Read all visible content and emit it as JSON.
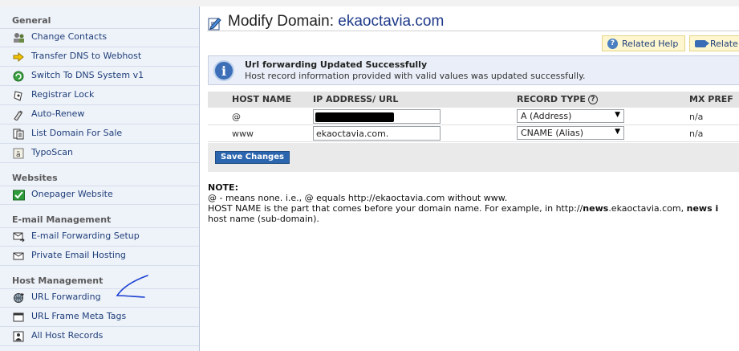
{
  "sidebar": {
    "sections": [
      {
        "title": "General",
        "items": [
          {
            "label": "Change Contacts",
            "icon": "contacts-icon"
          },
          {
            "label": "Transfer DNS to Webhost",
            "icon": "arrow-icon"
          },
          {
            "label": "Switch To DNS System v1",
            "icon": "switch-icon"
          },
          {
            "label": "Registrar Lock",
            "icon": "lock-icon"
          },
          {
            "label": "Auto-Renew",
            "icon": "renew-icon"
          },
          {
            "label": "List Domain For Sale",
            "icon": "sale-icon"
          },
          {
            "label": "TypoScan",
            "icon": "typoscan-icon"
          }
        ]
      },
      {
        "title": "Websites",
        "items": [
          {
            "label": "Onepager Website",
            "icon": "checkmark-icon"
          }
        ]
      },
      {
        "title": "E-mail Management",
        "items": [
          {
            "label": "E-mail Forwarding Setup",
            "icon": "email-forward-icon"
          },
          {
            "label": "Private Email Hosting",
            "icon": "envelope-icon"
          }
        ]
      },
      {
        "title": "Host Management",
        "items": [
          {
            "label": "URL Forwarding",
            "icon": "globe-icon"
          },
          {
            "label": "URL Frame Meta Tags",
            "icon": "frame-icon"
          },
          {
            "label": "All Host Records",
            "icon": "records-icon"
          }
        ]
      }
    ]
  },
  "header": {
    "title_prefix": "Modify Domain: ",
    "domain": "ekaoctavia.com",
    "related_help": "Related Help",
    "related_video": "Relate"
  },
  "alert": {
    "title": "Url forwarding Updated Successfully",
    "message": "Host record information provided with valid values was updated successfully."
  },
  "grid": {
    "headers": {
      "host": "HOST NAME",
      "ip": "IP ADDRESS/ URL",
      "type": "RECORD TYPE",
      "mx": "MX PREF"
    },
    "rows": [
      {
        "host": "@",
        "value": "",
        "redacted": true,
        "type": "A (Address)",
        "mx": "n/a"
      },
      {
        "host": "www",
        "value": "ekaoctavia.com.",
        "redacted": false,
        "type": "CNAME (Alias)",
        "mx": "n/a"
      }
    ]
  },
  "save_label": "Save Changes",
  "note": {
    "heading": "NOTE:",
    "line1": "@ - means none. i.e., @ equals http://ekaoctavia.com without www.",
    "line2_a": "HOST NAME is the part that comes before your domain name. For example, in http://",
    "line2_b": "news",
    "line2_c": ".ekaoctavia.com, ",
    "line2_d": "news i",
    "line3": "host name (sub-domain)."
  },
  "colors": {
    "accent": "#1f3a8a",
    "save_button": "#2b65ad",
    "sidebar_bg": "#eef2f9",
    "annotation_pen": "#1a3fd1"
  }
}
